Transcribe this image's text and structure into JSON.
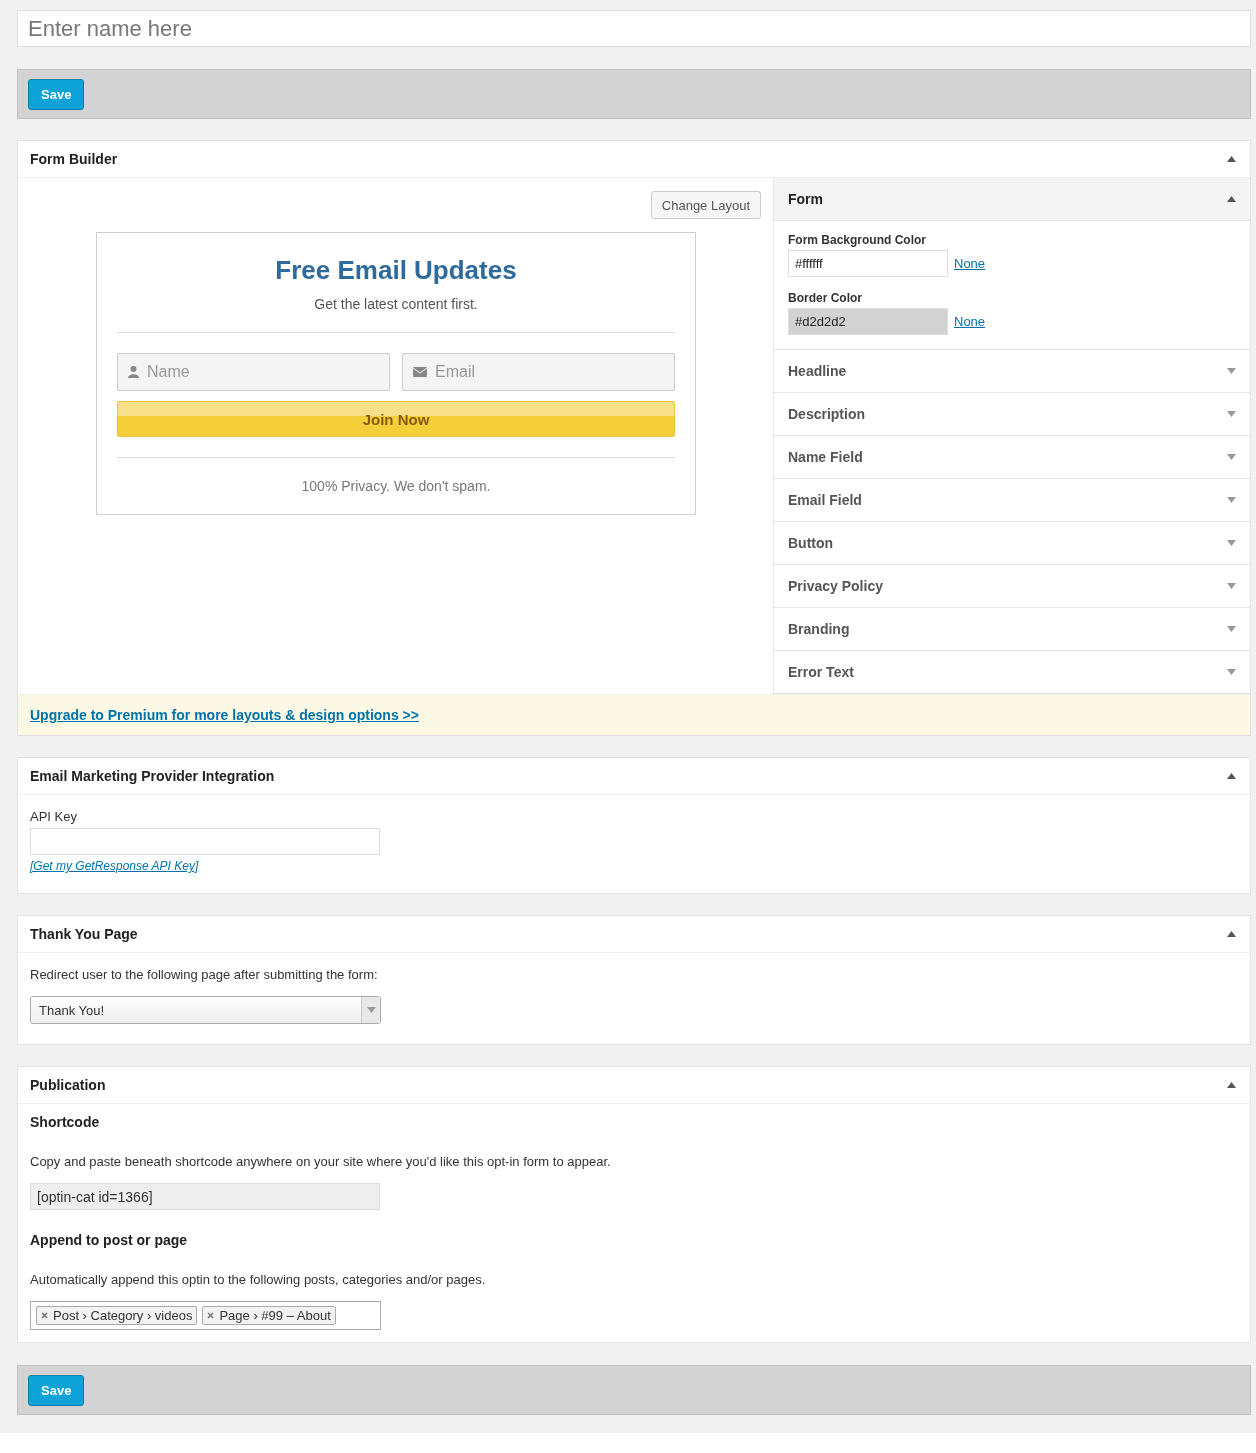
{
  "title_field": {
    "placeholder": "Enter name here"
  },
  "top_save": {
    "label": "Save"
  },
  "form_builder": {
    "title": "Form Builder",
    "expanded": true,
    "change_layout": "Change Layout",
    "preview": {
      "headline": "Free Email Updates",
      "description": "Get the latest content first.",
      "name_placeholder": "Name",
      "email_placeholder": "Email",
      "button": "Join Now",
      "privacy": "100% Privacy. We don't spam."
    },
    "settings": [
      {
        "label": "Form",
        "expanded": true,
        "fields": [
          {
            "label": "Form Background Color",
            "value": "#ffffff",
            "link": "None"
          },
          {
            "label": "Border Color",
            "value": "#d2d2d2",
            "link": "None"
          }
        ]
      },
      {
        "label": "Headline",
        "expanded": false
      },
      {
        "label": "Description",
        "expanded": false
      },
      {
        "label": "Name Field",
        "expanded": false
      },
      {
        "label": "Email Field",
        "expanded": false
      },
      {
        "label": "Button",
        "expanded": false
      },
      {
        "label": "Privacy Policy",
        "expanded": false
      },
      {
        "label": "Branding",
        "expanded": false
      },
      {
        "label": "Error Text",
        "expanded": false
      }
    ],
    "upgrade_link": "Upgrade to Premium for more layouts & design options >>"
  },
  "integration": {
    "title": "Email Marketing Provider Integration",
    "expanded": true,
    "api_label": "API Key",
    "api_link": "[Get my GetResponse API Key]"
  },
  "thank_you": {
    "title": "Thank You Page",
    "expanded": true,
    "text": "Redirect user to the following page after submitting the form:",
    "select_value": "Thank You!"
  },
  "publication": {
    "title": "Publication",
    "expanded": true,
    "shortcode_heading": "Shortcode",
    "shortcode_text": "Copy and paste beneath shortcode anywhere on your site where you'd like this opt-in form to appear.",
    "shortcode": "[optin-cat id=1366]",
    "append_heading": "Append to post or page",
    "append_text": "Automatically append this optin to the following posts, categories and/or pages.",
    "tags": [
      "Post › Category › videos",
      "Page › #99 – About"
    ]
  },
  "bottom_save": {
    "label": "Save"
  }
}
